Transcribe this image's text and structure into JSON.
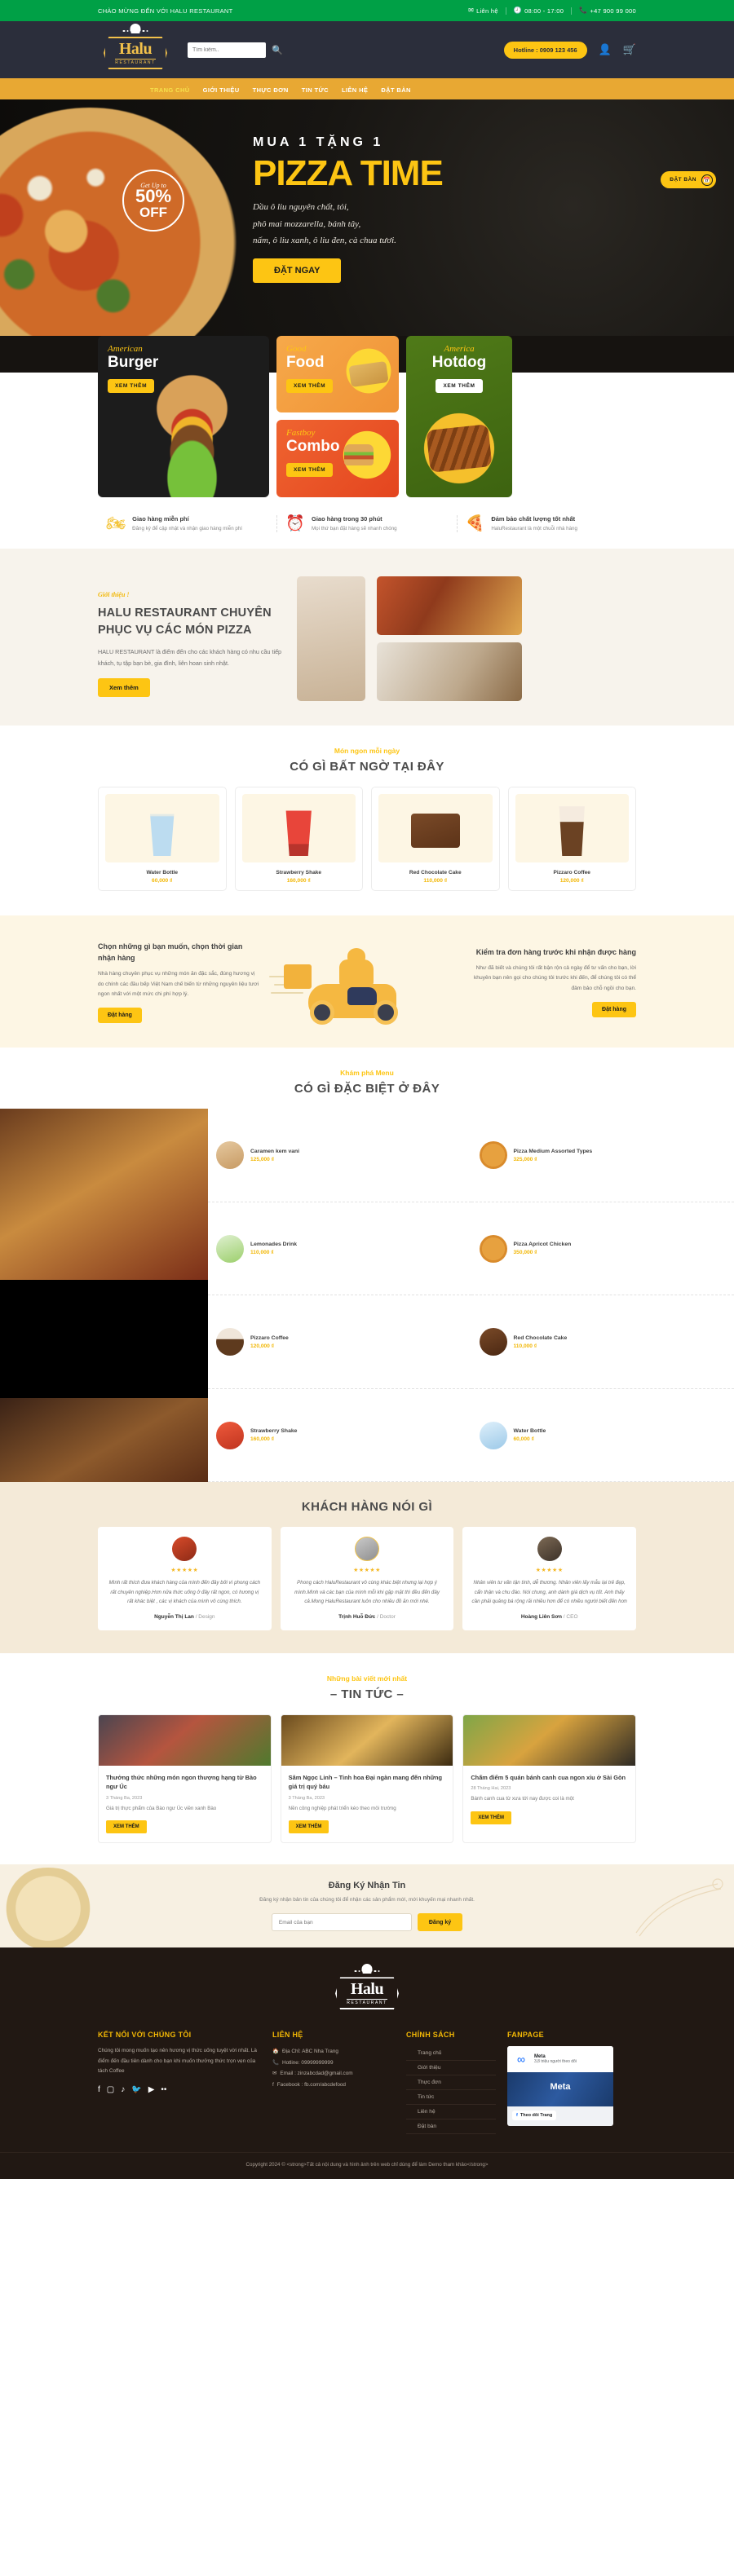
{
  "topbar": {
    "welcome": "CHÀO MỪNG ĐẾN VỚI HALU RESTAURANT",
    "contact_label": "Liên hệ",
    "hours": "08:00 - 17:00",
    "phone": "+47 900 99 000",
    "mail_icon": "mail-icon",
    "clock_icon": "clock-icon",
    "phone_icon": "phone-icon"
  },
  "header": {
    "logo_text": "Halu",
    "logo_sub": "RESTAURANT",
    "search_placeholder": "Tìm kiếm..",
    "search_value": "",
    "search_icon": "search-icon",
    "hotline": "Hotline : 0909 123 456",
    "account_icon": "user-icon",
    "cart_icon": "cart-icon"
  },
  "nav": {
    "items": [
      {
        "label": "TRANG CHỦ",
        "active": true
      },
      {
        "label": "GIỚI THIỆU",
        "active": false
      },
      {
        "label": "THỰC ĐƠN",
        "active": false
      },
      {
        "label": "TIN TỨC",
        "active": false
      },
      {
        "label": "LIÊN HỆ",
        "active": false
      },
      {
        "label": "ĐẶT BÀN",
        "active": false
      }
    ]
  },
  "hero": {
    "sup": "MUA 1 TẶNG 1",
    "title": "PIZZA TIME",
    "desc_line1": "Dầu ô liu nguyên chất, tỏi,",
    "desc_line2": "phô mai mozzarella, bánh tây,",
    "desc_line3": "nấm, ô liu xanh, ô liu đen, cà chua tươi.",
    "cta": "ĐẶT NGAY",
    "badge_small": "Get Up to",
    "badge_big": "50%",
    "badge_off": "OFF",
    "book_label": "ĐẶT BÀN",
    "book_icon": "calendar-icon",
    "accent": "#fdc513"
  },
  "promos": [
    {
      "script": "American",
      "title": "Burger",
      "btn": "XEM THÊM"
    },
    {
      "script": "Good",
      "title": "Food",
      "btn": "XEM THÊM"
    },
    {
      "script": "Fastboy",
      "title": "Combo",
      "btn": "XEM THÊM"
    },
    {
      "script": "America",
      "title": "Hotdog",
      "btn": "XEM THÊM"
    }
  ],
  "features": [
    {
      "icon": "scooter-icon",
      "title": "Giao hàng miễn phí",
      "desc": "Đăng ký để cập nhật và nhận giao hàng miễn phí"
    },
    {
      "icon": "stopwatch-icon",
      "title": "Giao hàng trong 30 phút",
      "desc": "Mọi thứ bạn đặt hàng sẽ nhanh chóng"
    },
    {
      "icon": "pizza-icon",
      "title": "Đảm bảo chất lượng tốt nhất",
      "desc": "HaluRestaurant là một chuỗi nhà hàng"
    }
  ],
  "about": {
    "kicker": "Giới thiệu !",
    "title_line1": "HALU RESTAURANT CHUYÊN",
    "title_line2": "PHỤC VỤ CÁC MÓN PIZZA",
    "paragraph": "HALU RESTAURANT là điểm đến cho các khách hàng có nhu cầu tiếp khách, tụ tập bạn bè, gia đình, liên hoan sinh nhật.",
    "cta": "Xem thêm"
  },
  "products_section": {
    "kicker": "Món ngon mỗi ngày",
    "title": "CÓ GÌ BẤT NGỜ TẠI ĐÂY",
    "items": [
      {
        "name": "Water Bottle",
        "price": "60,000 ₫",
        "thumb": "t-water"
      },
      {
        "name": "Strawberry Shake",
        "price": "160,000 ₫",
        "thumb": "t-shake"
      },
      {
        "name": "Red Chocolate Cake",
        "price": "110,000 ₫",
        "thumb": "t-cake"
      },
      {
        "name": "Pizzaro Coffee",
        "price": "120,000 ₫",
        "thumb": "t-coffee"
      }
    ]
  },
  "order_banner": {
    "left_title": "Chọn những gì bạn muốn, chọn thời gian nhận hàng",
    "left_text": "Nhà hàng chuyên phục vụ những món ăn đặc sắc, đúng hương vị do chính các đầu bếp Việt Nam chế biến từ những nguyên liệu tươi ngon nhất với một mức chi phí hợp lý.",
    "left_btn": "Đặt hàng",
    "right_title": "Kiểm tra đơn hàng trước khi nhận được hàng",
    "right_text": "Như đã biết và chúng tôi rất bận rộn cả ngày để tư vấn cho bạn, lời khuyên bạn nên gọi cho chúng tôi trước khi đến, để chúng tôi có thể đảm bảo chỗ ngồi cho bạn.",
    "right_btn": "Đặt hàng",
    "illustration": "delivery-scooter-illustration"
  },
  "menu_section": {
    "kicker": "Khám phá Menu",
    "title": "CÓ GÌ ĐẶC BIỆT Ở ĐÂY",
    "items": [
      {
        "name": "Caramen kem vani",
        "price": "125,000 ₫",
        "thumb": "mth-cake"
      },
      {
        "name": "Pizza Medium Assorted Types",
        "price": "325,000 ₫",
        "thumb": "mth-pizza"
      },
      {
        "name": "Lemonades Drink",
        "price": "110,000 ₫",
        "thumb": "mth-lemon"
      },
      {
        "name": "Pizza Apricot Chicken",
        "price": "350,000 ₫",
        "thumb": "mth-pizza"
      },
      {
        "name": "Pizzaro Coffee",
        "price": "120,000 ₫",
        "thumb": "mth-coffee"
      },
      {
        "name": "Red Chocolate Cake",
        "price": "110,000 ₫",
        "thumb": "mth-choco"
      },
      {
        "name": "Strawberry Shake",
        "price": "160,000 ₫",
        "thumb": "mth-shake"
      },
      {
        "name": "Water Bottle",
        "price": "60,000 ₫",
        "thumb": "mth-water"
      }
    ]
  },
  "testimonials": {
    "title": "KHÁCH HÀNG NÓI GÌ",
    "items": [
      {
        "stars": "★★★★★",
        "quote": "Mình rất thích đưa khách hàng của mình đến đây bởi vì phong cách rất chuyên nghiệp.Hơn nữa thức uống ở đây rất ngon, có hương vị rất khác biệt , các vị khách của mình vô cùng thích.",
        "name": "Nguyễn Thị Lan",
        "role": "/ Design",
        "avatar": "avatar-1"
      },
      {
        "stars": "★★★★★",
        "quote": "Phong cách HaluRestaurant vô cùng khác biệt nhưng lại hợp ý mình.Mình và các bạn của mình mỗi khi gặp mặt thì đều đến đây cả.Mong HaluRestaurant luôn cho nhiều đồ ăn mới nhé.",
        "name": "Trịnh Huỗ Đức",
        "role": "/ Doctor",
        "avatar": "avatar-2"
      },
      {
        "stars": "★★★★★",
        "quote": "Nhân viên tư vấn tận tình, dễ thương. Nhân viên lấy mẫu lại trẻ đẹp, cẩn thận và chu đáo. Nói chung, anh dành giá dịch vụ tốt. Anh thấy cần phải quảng bá rộng rãi nhiều hơn để có nhiều người biết đến hơn",
        "name": "Hoàng Liên Sơn",
        "role": "/ CEO",
        "avatar": "avatar-3"
      }
    ]
  },
  "news_section": {
    "kicker": "Những bài viết mới nhất",
    "title": "– TIN TỨC –",
    "items": [
      {
        "title": "Thưởng thức những món ngon thượng hạng từ Bào ngư Úc",
        "date": "3 Tháng Ba, 2023",
        "excerpt": "Giá trị thực phẩm của Bào ngư Úc viền xanh Bào",
        "btn": "XEM THÊM"
      },
      {
        "title": "Sâm Ngọc Linh – Tinh hoa Đại ngàn mang đến những giá trị quý báu",
        "date": "3 Tháng Ba, 2023",
        "excerpt": "Nền công nghiệp phát triển kéo theo môi trường",
        "btn": "XEM THÊM"
      },
      {
        "title": "Chấm điểm 5 quán bánh canh cua ngon xỉu ở Sài Gòn",
        "date": "28 Tháng Hai, 2023",
        "excerpt": "Bánh canh cua từ xưa tới nay được coi là một",
        "btn": "XEM THÊM"
      }
    ]
  },
  "newsletter": {
    "title": "Đăng Ký Nhận Tin",
    "sub": "Đăng ký nhận bản tin của chúng tôi để nhận các sản phẩm mới, mới khuyến mại nhanh nhất.",
    "placeholder": "Email của bạn",
    "value": "",
    "btn": "Đăng ký"
  },
  "footer": {
    "logo_text": "Halu",
    "logo_sub": "RESTAURANT",
    "col1_title": "KẾT NỐI VỚI CHÚNG TÔI",
    "col1_text": "Chúng tôi mong muốn tạo nên hương vị thức uống tuyệt vời nhất. Là điểm đến đầu tiên dành cho bạn khi muốn thưởng thức trọn vẹn của tách Coffee",
    "socials": [
      "facebook-icon",
      "instagram-icon",
      "tiktok-icon",
      "twitter-icon",
      "youtube-icon",
      "zalo-icon"
    ],
    "col2_title": "LIÊN HỆ",
    "contacts": [
      {
        "icon": "home-icon",
        "text": "Địa Chỉ: ABC Nha Trang"
      },
      {
        "icon": "phone-icon",
        "text": "Hotline: 09999999999"
      },
      {
        "icon": "mail-icon",
        "text": "Email : zinzabcdad@gmail.com"
      },
      {
        "icon": "facebook-icon",
        "text": "Facebook : fb.com/abcdefood"
      }
    ],
    "col3_title": "CHÍNH SÁCH",
    "links": [
      "Trang chủ",
      "Giới thiệu",
      "Thực đơn",
      "Tin tức",
      "Liên hệ",
      "Đặt bàn"
    ],
    "col4_title": "FANPAGE",
    "fanpage_name": "Meta",
    "fanpage_followers": "3,8 triệu người theo dõi",
    "fanpage_cover_text": "Meta",
    "fanpage_follow_btn": "Theo dõi Trang",
    "copyright": "Copyright 2024 © <strong>Tất cả nội dung và hình ảnh trên web chỉ dùng để làm Demo tham khảo</strong>"
  }
}
